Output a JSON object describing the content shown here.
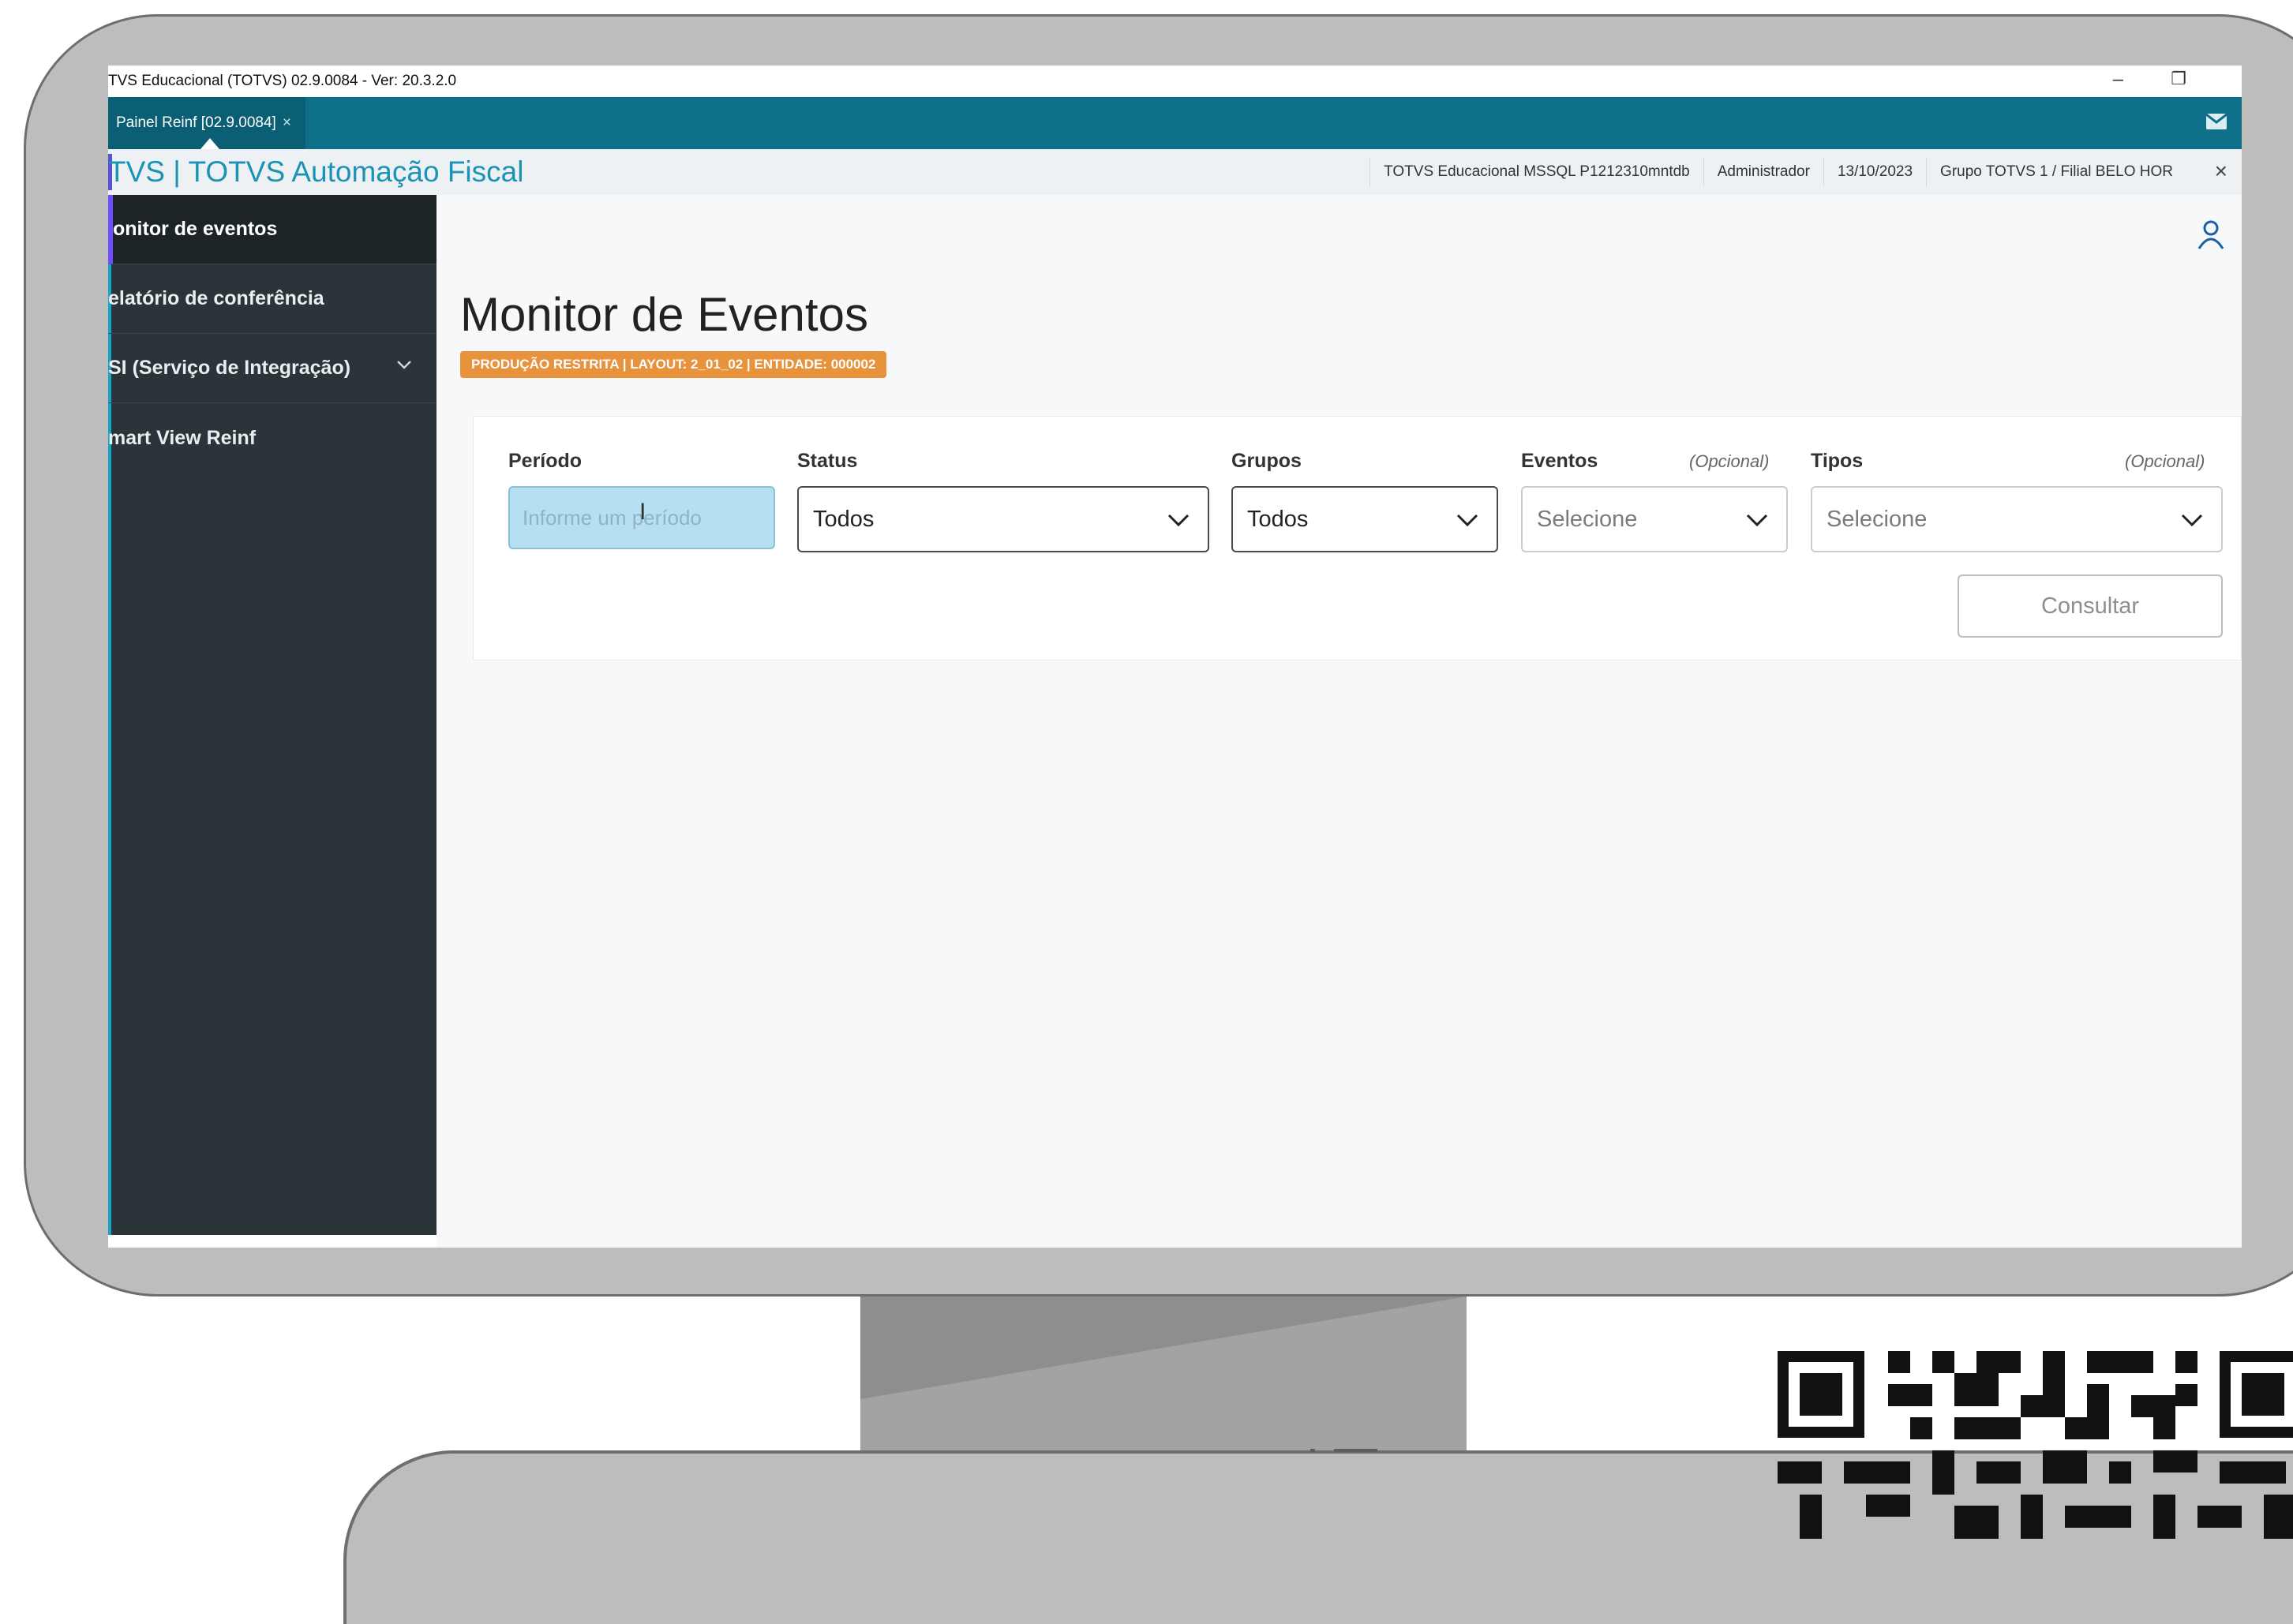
{
  "window": {
    "title": "TVS Educacional (TOTVS) 02.9.0084 - Ver: 20.3.2.0",
    "minimize": "–",
    "restore": "❐"
  },
  "tabbar": {
    "tab_label": "Painel Reinf [02.9.0084]",
    "tab_close": "×"
  },
  "header": {
    "brand": "TVS | TOTVS Automação Fiscal",
    "info": [
      "TOTVS Educacional MSSQL P1212310mntdb",
      "Administrador",
      "13/10/2023",
      "Grupo TOTVS 1 / Filial BELO HOR"
    ],
    "close": "×"
  },
  "sidebar": {
    "items": [
      {
        "label": "onitor de eventos"
      },
      {
        "label": "elatório de conferência"
      },
      {
        "label": "SI (Serviço de Integração)"
      },
      {
        "label": "mart View Reinf"
      }
    ]
  },
  "main": {
    "page_title": "Monitor de Eventos",
    "badge": "PRODUÇÃO RESTRITA | LAYOUT: 2_01_02 | ENTIDADE: 000002",
    "filters": {
      "periodo": {
        "label": "Período",
        "placeholder": "Informe um período"
      },
      "status": {
        "label": "Status",
        "value": "Todos"
      },
      "grupos": {
        "label": "Grupos",
        "value": "Todos"
      },
      "eventos": {
        "label": "Eventos",
        "optional": "(Opcional)",
        "value": "Selecione"
      },
      "tipos": {
        "label": "Tipos",
        "optional": "(Opcional)",
        "value": "Selecione"
      }
    },
    "consultar_label": "Consultar"
  },
  "colors": {
    "tabbar": "#0e7088",
    "sidebar": "#2b3438",
    "brand": "#1a93b6",
    "badge": "#e8923b",
    "active_accent": "#6f4cff"
  }
}
